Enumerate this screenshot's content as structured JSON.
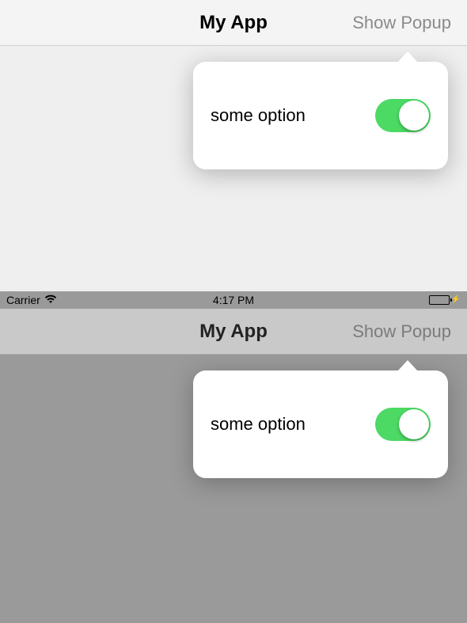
{
  "top": {
    "nav_title": "My App",
    "nav_right": "Show Popup",
    "popover": {
      "label": "some option",
      "toggle_on": true
    }
  },
  "bottom": {
    "status": {
      "carrier": "Carrier",
      "time": "4:17 PM"
    },
    "nav_title": "My App",
    "nav_right": "Show Popup",
    "popover": {
      "label": "some option",
      "toggle_on": true
    }
  },
  "colors": {
    "ios_green": "#4cd964"
  }
}
